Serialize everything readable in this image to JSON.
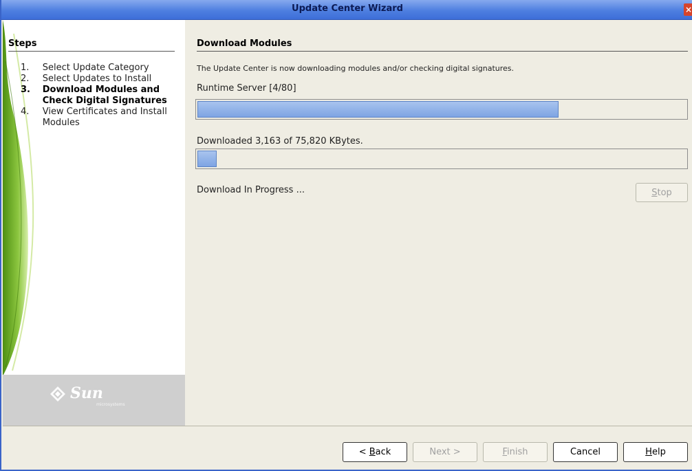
{
  "window": {
    "title": "Update Center Wizard",
    "close_glyph": "×"
  },
  "steps": {
    "heading": "Steps",
    "items": [
      {
        "num": "1.",
        "label": "Select Update Category",
        "current": false
      },
      {
        "num": "2.",
        "label": "Select Updates to Install",
        "current": false
      },
      {
        "num": "3.",
        "label": "Download Modules and Check Digital Signatures",
        "current": true
      },
      {
        "num": "4.",
        "label": "View Certificates and Install Modules",
        "current": false
      }
    ]
  },
  "logo": {
    "text": "Sun",
    "subtext": "microsystems"
  },
  "main": {
    "heading": "Download Modules",
    "description": "The Update Center is now downloading modules and/or checking digital signatures.",
    "runtime_label": "Runtime Server [4/80]",
    "runtime_progress": 0.74,
    "download_label": "Downloaded 3,163 of 75,820 KBytes.",
    "download_progress": 0.04,
    "status": "Download In Progress ...",
    "stop_label": "Stop"
  },
  "buttons": {
    "back": "< Back",
    "next": "Next >",
    "finish": "Finish",
    "cancel": "Cancel",
    "help": "Help"
  },
  "colors": {
    "titlebar": "#4e7fe0",
    "progress_fill": "#7ea4e3",
    "accent_green": "#7fb82a"
  }
}
